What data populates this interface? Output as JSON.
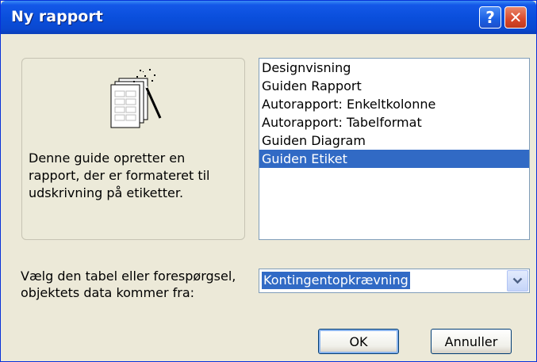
{
  "window": {
    "title": "Ny rapport",
    "help_label": "?",
    "close_label": "✕"
  },
  "preview": {
    "illustration_icon": "report-wizard-wand-icon",
    "description": "Denne guide opretter en rapport, der er formateret til udskrivning på etiketter."
  },
  "report_types": {
    "items": [
      {
        "label": "Designvisning"
      },
      {
        "label": "Guiden Rapport"
      },
      {
        "label": "Autorapport: Enkeltkolonne"
      },
      {
        "label": "Autorapport: Tabelformat"
      },
      {
        "label": "Guiden Diagram"
      },
      {
        "label": "Guiden Etiket"
      }
    ],
    "selected": "Guiden Etiket"
  },
  "source": {
    "label": "Vælg den tabel eller forespørgsel, objektets data kommer fra:",
    "value": "Kontingentopkrævning",
    "dropdown_icon": "chevron-down-icon"
  },
  "buttons": {
    "ok": "OK",
    "cancel": "Annuller"
  },
  "colors": {
    "title_bar": "#0a4fdc",
    "selection": "#316ac5",
    "dialog_bg": "#ece9d8"
  }
}
